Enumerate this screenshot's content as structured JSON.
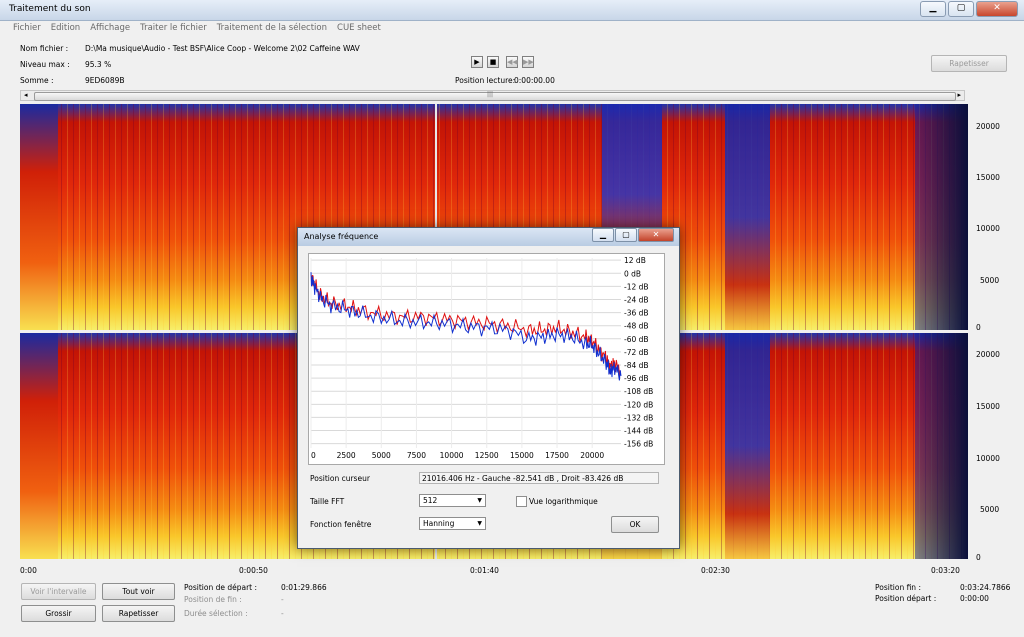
{
  "window": {
    "title": "Traitement du son",
    "min_btn": "▁",
    "max_btn": "▢",
    "close_btn": "✕"
  },
  "menu": [
    "Fichier",
    "Edition",
    "Affichage",
    "Traiter le fichier",
    "Traitement de la sélection",
    "CUE sheet"
  ],
  "file_info": {
    "name_label": "Nom fichier :",
    "name_value": "D:\\Ma musique\\Audio - Test BSF\\Alice Coop - Welcome 2\\02 Caffeine WAV",
    "level_label": "Niveau max :",
    "level_value": "95.3 %",
    "checksum_label": "Somme :",
    "checksum_value": "9ED6089B"
  },
  "transport": {
    "play": "▶",
    "stop": "■",
    "rewind": "◀◀",
    "forward": "▶▶",
    "position_label": "Position lecture:",
    "position_value": "0:00:00.00"
  },
  "rapetisser_top": "Rapetisser",
  "scroll_grip": "|||",
  "spectrogram": {
    "freq_ticks": [
      "20000",
      "15000",
      "10000",
      "5000",
      "0"
    ],
    "time_ticks": [
      "0:00",
      "0:00:50",
      "0:01:40",
      "0:02:30",
      "0:03:20"
    ]
  },
  "bottom": {
    "btn_interval": "Voir l'intervalle",
    "btn_all": "Tout voir",
    "btn_zoom_in": "Grossir",
    "btn_zoom_out": "Rapetisser",
    "start_label": "Position de départ :",
    "start_value": "0:01:29.866",
    "end_label": "Position de fin :",
    "end_value": "-",
    "duration_label": "Durée sélection :",
    "duration_value": "-",
    "pos_end_label": "Position fin :",
    "pos_end_value": "0:03:24.7866",
    "pos_start_label": "Position départ :",
    "pos_start_value": "0:00:00"
  },
  "dialog": {
    "title": "Analyse fréquence",
    "cursor_label": "Position curseur",
    "cursor_value": "21016.406 Hz  -  Gauche -82.541 dB , Droit -83.426 dB",
    "fft_label": "Taille FFT",
    "fft_value": "512",
    "log_label": "Vue logarithmique",
    "window_label": "Fonction fenêtre",
    "window_value": "Hanning",
    "ok": "OK"
  },
  "chart_data": {
    "type": "line",
    "xlabel": "",
    "ylabel": "",
    "x_ticks": [
      "0",
      "2500",
      "5000",
      "7500",
      "10000",
      "12500",
      "15000",
      "17500",
      "20000"
    ],
    "y_ticks": [
      "12 dB",
      "0 dB",
      "-12 dB",
      "-24 dB",
      "-36 dB",
      "-48 dB",
      "-60 dB",
      "-72 dB",
      "-84 dB",
      "-96 dB",
      "-108 dB",
      "-120 dB",
      "-132 dB",
      "-144 dB",
      "-156 dB"
    ],
    "xlim": [
      0,
      22050
    ],
    "ylim": [
      -160,
      14
    ],
    "grid": true,
    "series": [
      {
        "color": "#e01010",
        "x": [
          0,
          300,
          800,
          1500,
          2500,
          3500,
          5000,
          6500,
          8000,
          9500,
          11000,
          12500,
          14000,
          15500,
          16500,
          17500,
          18500,
          19500,
          20000,
          20500,
          21000,
          21300,
          21600,
          22050
        ],
        "y": [
          -2,
          -12,
          -22,
          -28,
          -30,
          -34,
          -38,
          -40,
          -40,
          -42,
          -44,
          -46,
          -48,
          -52,
          -52,
          -50,
          -54,
          -58,
          -62,
          -70,
          -78,
          -86,
          -82,
          -90
        ]
      },
      {
        "color": "#1030d0",
        "x": [
          0,
          300,
          800,
          1500,
          2500,
          3500,
          5000,
          6500,
          8000,
          9500,
          11000,
          12500,
          14000,
          15500,
          16500,
          17500,
          18500,
          19500,
          20000,
          20500,
          21000,
          21300,
          21600,
          22050
        ],
        "y": [
          -4,
          -14,
          -24,
          -30,
          -33,
          -37,
          -41,
          -44,
          -45,
          -46,
          -49,
          -50,
          -52,
          -60,
          -58,
          -56,
          -58,
          -64,
          -66,
          -74,
          -82,
          -90,
          -86,
          -94
        ]
      }
    ]
  }
}
